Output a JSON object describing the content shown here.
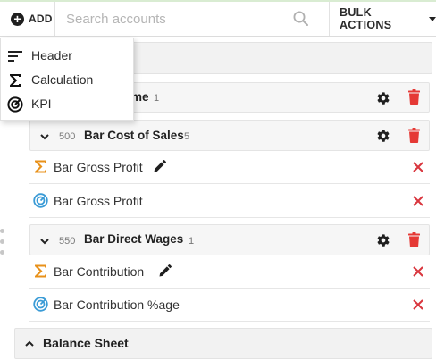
{
  "toolbar": {
    "add_label": "ADD",
    "search_placeholder": "Search accounts",
    "bulk_label": "BULK ACTIONS"
  },
  "add_menu": [
    {
      "label": "Header",
      "icon": "header-lines-icon"
    },
    {
      "label": "Calculation",
      "icon": "sigma-icon"
    },
    {
      "label": "KPI",
      "icon": "kpi-gauge-icon"
    }
  ],
  "sections": {
    "income_partial": "me",
    "income_count": "1",
    "balance_sheet": "Balance Sheet"
  },
  "groups": [
    {
      "code": "500",
      "name": "Bar Cost of Sales",
      "count": "5"
    },
    {
      "code": "550",
      "name": "Bar Direct Wages",
      "count": "1"
    }
  ],
  "items": [
    {
      "label": "Bar Gross Profit",
      "type": "calculation",
      "editable": true
    },
    {
      "label": "Bar Gross Profit",
      "type": "kpi",
      "editable": false
    },
    {
      "label": "Bar Contribution",
      "type": "calculation",
      "editable": true
    },
    {
      "label": "Bar Contribution %age",
      "type": "kpi",
      "editable": false
    }
  ],
  "colors": {
    "sigma": "#e8911a",
    "kpi": "#3a9bd6",
    "danger": "#e53935",
    "x_red": "#d9363e"
  }
}
